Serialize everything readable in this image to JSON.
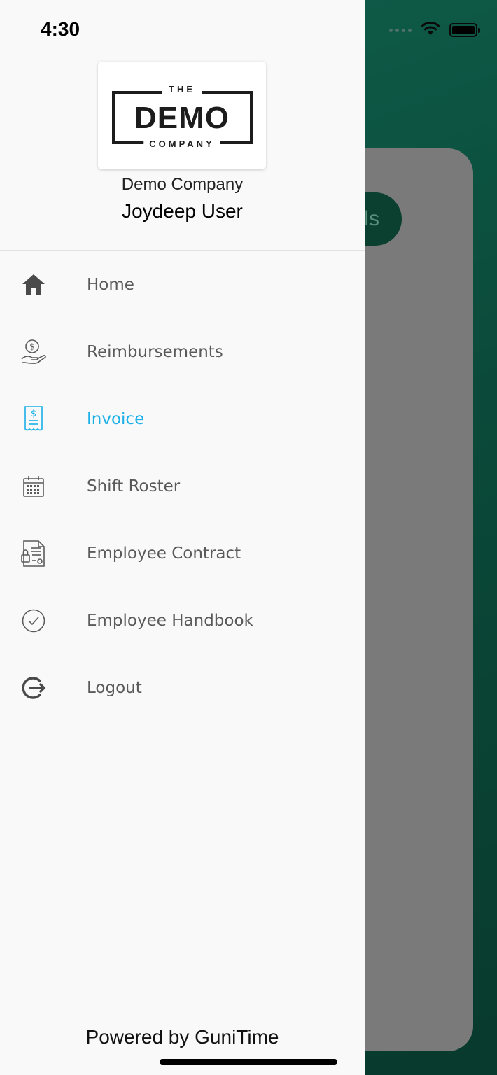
{
  "status_bar": {
    "time": "4:30"
  },
  "logo": {
    "line1": "THE",
    "line2": "DEMO",
    "line3": "COMPANY"
  },
  "profile": {
    "company": "Demo Company",
    "user": "Joydeep User"
  },
  "menu": {
    "items": [
      {
        "label": "Home",
        "icon": "home-icon"
      },
      {
        "label": "Reimbursements",
        "icon": "money-hand-icon"
      },
      {
        "label": "Invoice",
        "icon": "invoice-icon",
        "active": true
      },
      {
        "label": "Shift Roster",
        "icon": "calendar-icon"
      },
      {
        "label": "Employee Contract",
        "icon": "contract-icon"
      },
      {
        "label": "Employee Handbook",
        "icon": "check-circle-icon"
      },
      {
        "label": "Logout",
        "icon": "logout-icon"
      }
    ]
  },
  "footer": {
    "powered_by": "Powered by GuniTime"
  },
  "background": {
    "button_text_fragment": "ls"
  },
  "colors": {
    "active": "#1ab0e8",
    "text": "#5a5a5a",
    "drawer_bg": "#f9f9f9",
    "app_green": "#0f5e4b",
    "overlay_card": "#7a7a7a"
  }
}
